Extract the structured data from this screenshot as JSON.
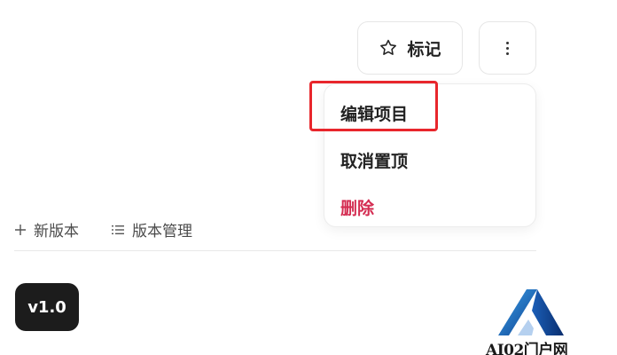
{
  "header": {
    "mark_label": "标记",
    "more_icon": "kebab-vertical-icon",
    "mark_icon": "star-outline-icon"
  },
  "menu": {
    "items": [
      {
        "label": "编辑项目",
        "highlighted": true
      },
      {
        "label": "取消置顶"
      },
      {
        "label": "删除",
        "color": "#d42d52"
      }
    ]
  },
  "toolbar": {
    "new_version_label": "新版本",
    "manage_versions_label": "版本管理"
  },
  "version": {
    "badge_label": "v1.0"
  },
  "watermark": {
    "text": "AI02门户网"
  },
  "colors": {
    "highlight": "#e8262c",
    "delete": "#d42d52",
    "badge_bg": "#1c1c1c"
  }
}
